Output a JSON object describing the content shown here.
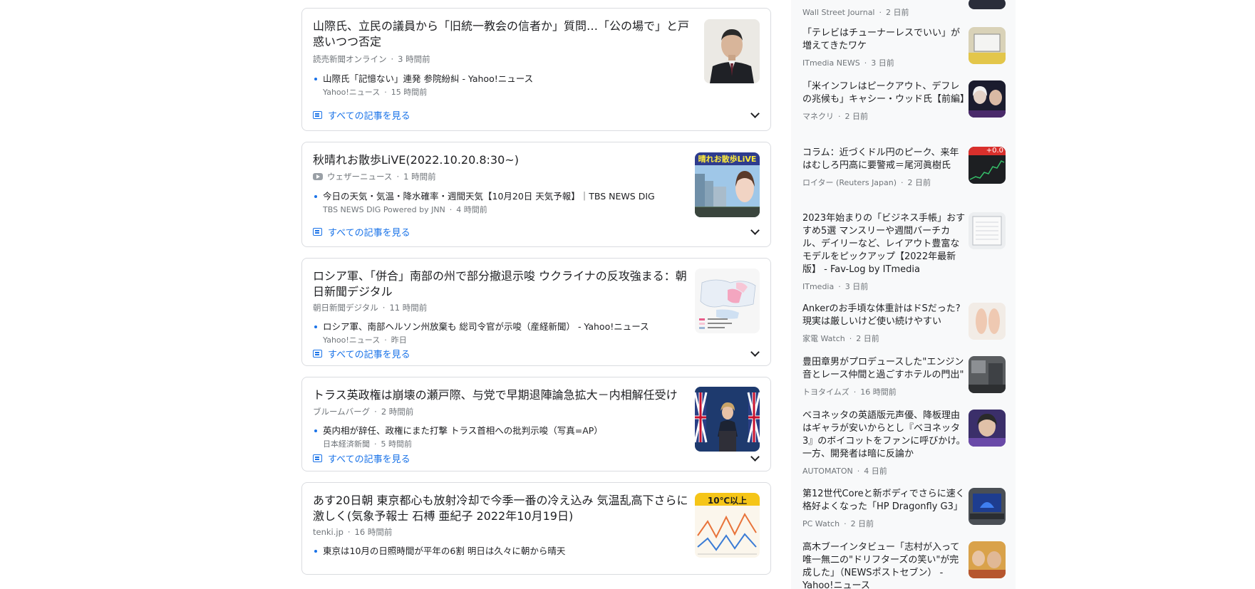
{
  "see_all_label": "すべての記事を見る",
  "stories": [
    {
      "title": "山際氏、立民の議員から「旧統一教会の信者か」質問…「公の場で」と戸惑いつつ否定",
      "source": "読売新聞オンライン",
      "time": "3 時間前",
      "related": {
        "title": "山際氏「記憶ない」連発 参院紛糾 - Yahoo!ニュース",
        "source": "Yahoo!ニュース",
        "time": "15 時間前"
      },
      "thumb_icon": "portrait-photo"
    },
    {
      "title": "秋晴れお散歩LiVE(2022.10.20.8:30~)",
      "source": "ウェザーニュース",
      "time": "1 時間前",
      "source_icon": "youtube-icon",
      "related": {
        "title": "今日の天気・気温・降水確率・週間天気【10月20日 天気予報】｜TBS NEWS DIG",
        "source": "TBS NEWS DIG Powered by JNN",
        "time": "4 時間前"
      },
      "thumb_caption": "晴れお散歩LiVE"
    },
    {
      "title": "ロシア軍、「併合」南部の州で部分撤退示唆 ウクライナの反攻強まる：朝日新聞デジタル",
      "source": "朝日新聞デジタル",
      "time": "11 時間前",
      "related": {
        "title": "ロシア軍、南部ヘルソン州放棄も 総司令官が示唆（産経新聞） - Yahoo!ニュース",
        "source": "Yahoo!ニュース",
        "time": "昨日"
      },
      "thumb_icon": "map-graphic"
    },
    {
      "title": "トラス英政権は崩壊の瀬戸際、与党で早期退陣論急拡大－内相解任受け",
      "source": "ブルームバーグ",
      "time": "2 時間前",
      "related": {
        "title": "英内相が辞任、政権にまた打撃 トラス首相への批判示唆（写真=AP）",
        "source": "日本経済新聞",
        "time": "5 時間前"
      },
      "thumb_icon": "podium-photo"
    },
    {
      "title": "あす20日朝 東京都心も放射冷却で今季一番の冷え込み 気温乱高下さらに激しく(気象予報士 石榑 亜紀子 2022年10月19日)",
      "source": "tenki.jp",
      "time": "16 時間前",
      "related": {
        "title": "東京は10月の日照時間が平年の6割 明日は久々に朝から晴天"
      },
      "thumb_caption": "10℃以上"
    }
  ],
  "sidebar": {
    "top_fragment": {
      "source": "Wall Street Journal",
      "time": "2 日前"
    },
    "items": [
      {
        "title": "「テレビはチューナーレスでいい」が増えてきたワケ",
        "source": "ITmedia NEWS",
        "time": "3 日前",
        "thumb_icon": "tv-photo"
      },
      {
        "title": "「米インフレはピークアウト、デフレの兆候も」キャシー・ウッド氏【前編】",
        "source": "マネクリ",
        "time": "2 日前",
        "thumb_icon": "interview-photo"
      },
      {
        "title": "コラム：近づくドル円のピーク、来年はむしろ円高に要警戒＝尾河眞樹氏",
        "source": "ロイター (Reuters Japan)",
        "time": "2 日前",
        "thumb_caption": "+0.0"
      },
      {
        "title": "2023年始まりの「ビジネス手帳」おすすめ5選 マンスリーや週間バーチカル、デイリーなど、レイアウト豊富なモデルをピックアップ【2022年最新版】 - Fav-Log by ITmedia",
        "source": "ITmedia",
        "time": "3 日前",
        "thumb_icon": "notebook-photo"
      },
      {
        "title": "Ankerのお手頃な体重計はドSだった?現実は厳しいけど使い続けやすい",
        "source": "家電 Watch",
        "time": "2 日前",
        "thumb_icon": "scale-photo"
      },
      {
        "title": "豊田章男がプロデュースした\"エンジン音とレース仲間と過ごすホテルの門出\"",
        "source": "トヨタイムズ",
        "time": "16 時間前",
        "thumb_icon": "hotel-photo"
      },
      {
        "title": "ベヨネッタの英語版元声優、降板理由はギャラが安いからとし『ベヨネッタ3』のボイコットをファンに呼びかけ。一方、開発者は暗に反論か",
        "source": "AUTOMATON",
        "time": "4 日前",
        "thumb_icon": "person-photo"
      },
      {
        "title": "第12世代Coreと新ボディでさらに速く格好よくなった「HP Dragonfly G3」",
        "source": "PC Watch",
        "time": "2 日前",
        "thumb_icon": "laptop-photo"
      },
      {
        "title": "高木ブーインタビュー「志村が入って唯一無二の\"ドリフターズの笑い\"が完成した」（NEWSポストセブン） - Yahoo!ニュース",
        "thumb_icon": "group-photo"
      }
    ]
  }
}
